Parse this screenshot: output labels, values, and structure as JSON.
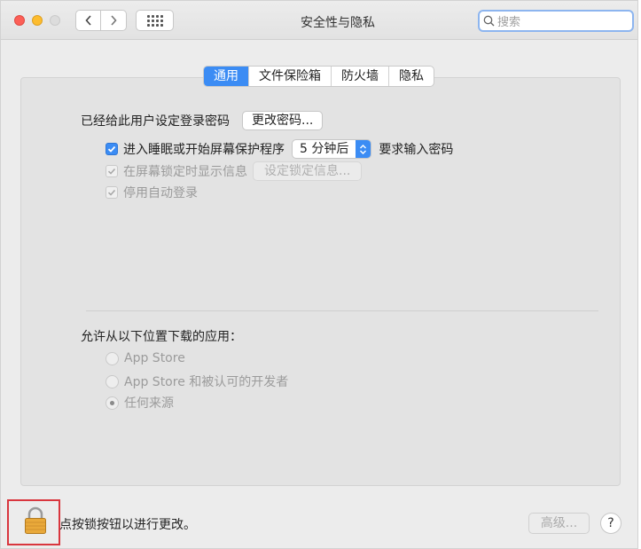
{
  "window": {
    "title": "安全性与隐私",
    "search_placeholder": "搜索"
  },
  "tabs": [
    {
      "label": "通用",
      "active": true
    },
    {
      "label": "文件保险箱",
      "active": false
    },
    {
      "label": "防火墙",
      "active": false
    },
    {
      "label": "隐私",
      "active": false
    }
  ],
  "general": {
    "password_label": "已经给此用户设定登录密码",
    "change_password_button": "更改密码...",
    "require_password": {
      "checked": true,
      "label": "进入睡眠或开始屏幕保护程序",
      "delay_value": "5 分钟后",
      "suffix": "要求输入密码"
    },
    "show_message": {
      "checked": true,
      "label": "在屏幕锁定时显示信息",
      "button": "设定锁定信息..."
    },
    "disable_autologin": {
      "checked": true,
      "label": "停用自动登录"
    }
  },
  "downloads": {
    "heading": "允许从以下位置下载的应用：",
    "options": [
      {
        "label": "App Store",
        "selected": false
      },
      {
        "label": "App Store 和被认可的开发者",
        "selected": false
      },
      {
        "label": "任何来源",
        "selected": true
      }
    ]
  },
  "footer": {
    "lock_text": "点按锁按钮以进行更改。",
    "advanced_button": "高级...",
    "help_button": "?"
  },
  "colors": {
    "accent": "#3b8cf4",
    "highlight_frame": "#d9363e"
  }
}
